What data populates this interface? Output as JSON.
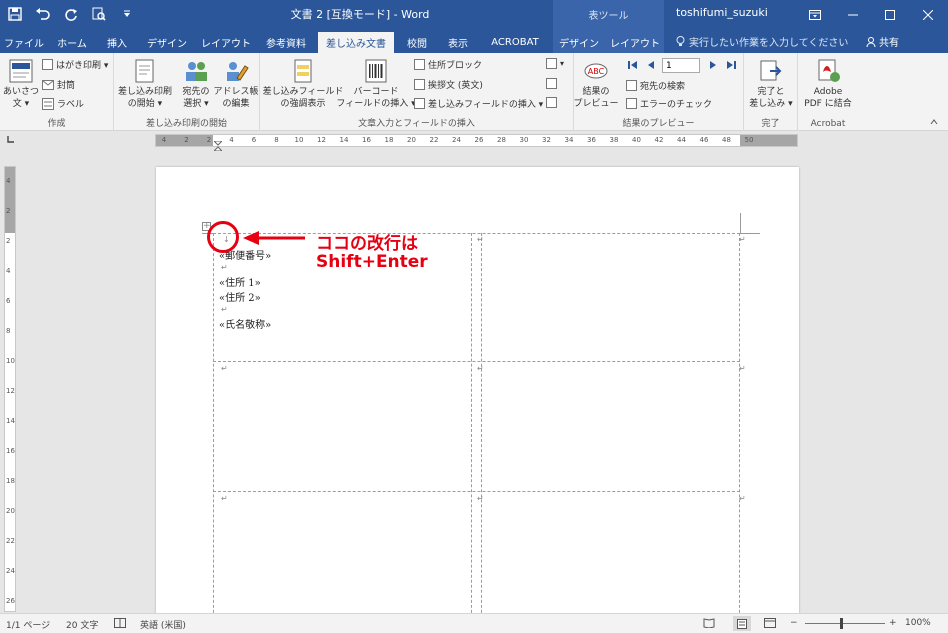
{
  "window": {
    "doc_title": "文書 2 [互換モード] - Word",
    "tool_tab_header": "表ツール",
    "user": "toshifumi_suzuki"
  },
  "tabs": [
    {
      "label": "ファイル"
    },
    {
      "label": "ホーム"
    },
    {
      "label": "挿入"
    },
    {
      "label": "デザイン"
    },
    {
      "label": "レイアウト"
    },
    {
      "label": "参考資料"
    },
    {
      "label": "差し込み文書"
    },
    {
      "label": "校閲"
    },
    {
      "label": "表示"
    },
    {
      "label": "ACROBAT"
    },
    {
      "label": "デザイン"
    },
    {
      "label": "レイアウト"
    }
  ],
  "tellme": "実行したい作業を入力してください",
  "share": "共有",
  "ribbon": {
    "create": {
      "label": "作成",
      "greeting_1": "あいさつ",
      "greeting_2": "文 ▾",
      "postcard": "はがき印刷 ▾",
      "envelope": "封筒",
      "label_btn": "ラベル"
    },
    "start": {
      "label": "差し込み印刷の開始",
      "start_1": "差し込み印刷",
      "start_2": "の開始 ▾",
      "recipients_1": "宛先の",
      "recipients_2": "選択 ▾",
      "edit_1": "アドレス帳",
      "edit_2": "の編集"
    },
    "write": {
      "label": "文章入力とフィールドの挿入",
      "highlight_1": "差し込みフィールド",
      "highlight_2": "の強調表示",
      "barcode_1": "バーコード",
      "barcode_2": "フィールドの挿入 ▾",
      "address_block": "住所ブロック",
      "greeting_line": "挨拶文 (英文)",
      "insert_field": "差し込みフィールドの挿入 ▾"
    },
    "preview": {
      "label": "結果のプレビュー",
      "preview_1": "結果の",
      "preview_2": "プレビュー",
      "record": "1",
      "find": "宛先の検索",
      "check": "エラーのチェック"
    },
    "finish": {
      "label": "完了",
      "finish_1": "完了と",
      "finish_2": "差し込み ▾"
    },
    "acrobat": {
      "label": "Acrobat",
      "pdf_1": "Adobe",
      "pdf_2": "PDF に結合"
    }
  },
  "ruler_numbers": [
    "4",
    "2",
    "2",
    "4",
    "6",
    "8",
    "10",
    "12",
    "14",
    "16",
    "18",
    "20",
    "22",
    "24",
    "26",
    "28",
    "30",
    "32",
    "34",
    "36",
    "38",
    "40",
    "42",
    "44",
    "46",
    "48",
    "50"
  ],
  "vruler_numbers": [
    "4",
    "2",
    "2",
    "4",
    "6",
    "8",
    "10",
    "12",
    "14",
    "16",
    "18",
    "20",
    "22",
    "24",
    "26"
  ],
  "document": {
    "fields": [
      "«郵便番号»",
      "«住所 1»",
      "«住所 2»",
      "«氏名敬称»"
    ]
  },
  "annotation": {
    "line1": "ココの改行は",
    "line2": "Shift+Enter",
    "color": "#e60012"
  },
  "status": {
    "page": "1/1 ページ",
    "words": "20 文字",
    "language": "英語 (米国)",
    "zoom": "100%"
  },
  "colors": {
    "accent": "#2b579a"
  }
}
